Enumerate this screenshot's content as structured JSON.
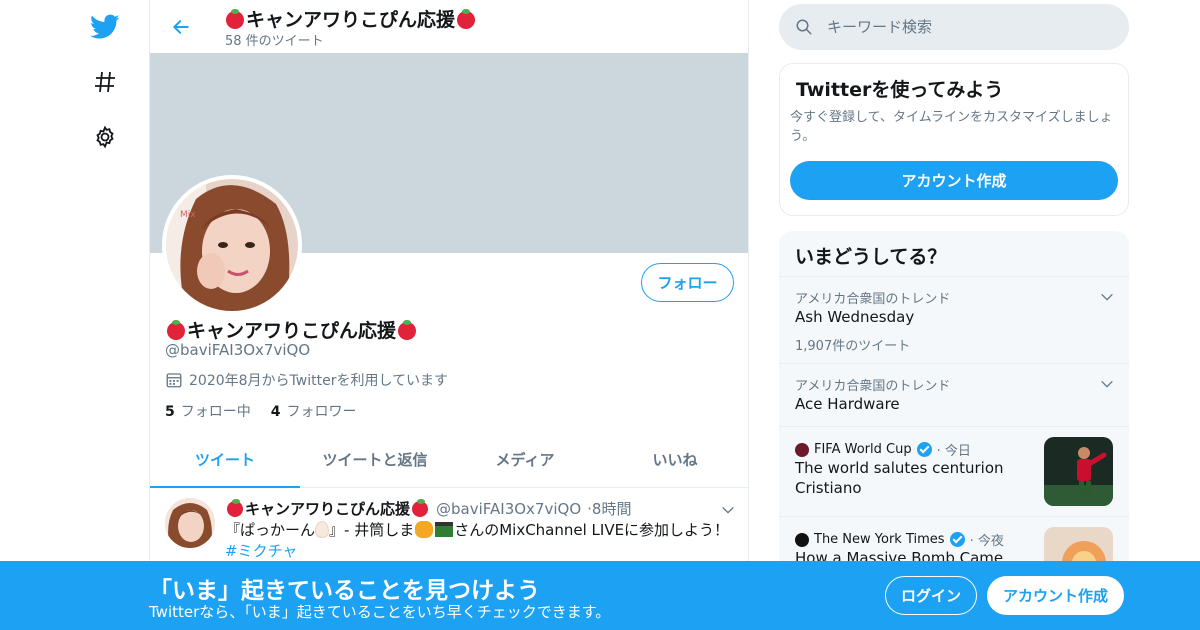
{
  "header": {
    "title": "キャンアワりこぴん応援",
    "tweet_count": "58 件のツイート"
  },
  "profile": {
    "name": "キャンアワりこぴん応援",
    "handle": "@baviFAI3Ox7viQO",
    "joined": "2020年8月からTwitterを利用しています",
    "following_count": "5",
    "following_label": "フォロー中",
    "followers_count": "4",
    "followers_label": "フォロワー",
    "follow_button": "フォロー"
  },
  "tabs": [
    {
      "label": "ツイート",
      "active": true
    },
    {
      "label": "ツイートと返信",
      "active": false
    },
    {
      "label": "メディア",
      "active": false
    },
    {
      "label": "いいね",
      "active": false
    }
  ],
  "tweet": {
    "name": "キャンアワりこぴん応援",
    "handle": "@baviFAI3Ox7viQO",
    "time": "8時間",
    "text_before": "『ぱっかーん",
    "text_mid": "』- 井筒しま",
    "text_after": "さんのMixChannel LIVEに参加しよう！",
    "hashtag": "#ミクチャ"
  },
  "search": {
    "placeholder": "キーワード検索"
  },
  "signup_card": {
    "title": "Twitterを使ってみよう",
    "description": "今すぐ登録して、タイムラインをカスタマイズしましょう。",
    "button": "アカウント作成"
  },
  "trends": {
    "title": "いまどうしてる？",
    "items": [
      {
        "context": "アメリカ合衆国のトレンド",
        "name": "Ash Wednesday",
        "count": "1,907件のツイート"
      },
      {
        "context": "アメリカ合衆国のトレンド",
        "name": "Ace Hardware"
      }
    ],
    "news": [
      {
        "source": "FIFA World Cup",
        "time": "今日",
        "headline": "The world salutes centurion Cristiano"
      },
      {
        "source": "The New York Times",
        "time": "今夜",
        "headline": "How a Massive Bomb Came"
      }
    ]
  },
  "bottom_bar": {
    "title": "「いま」起きていることを見つけよう",
    "subtitle": "Twitterなら、「いま」起きていることをいち早くチェックできます。",
    "login": "ログイン",
    "signup": "アカウント作成"
  },
  "colors": {
    "accent": "#1da1f2",
    "banner": "#ccd6dd",
    "muted_text": "#657786",
    "border": "#e6ecf0"
  },
  "icons": [
    "twitter-bird-icon",
    "hashtag-icon",
    "gear-icon",
    "back-arrow-icon",
    "search-icon",
    "calendar-icon",
    "chevron-down-icon",
    "verified-icon",
    "tomato-emoji-icon",
    "egg-emoji-icon",
    "tiger-emoji-icon",
    "clapper-emoji-icon"
  ]
}
